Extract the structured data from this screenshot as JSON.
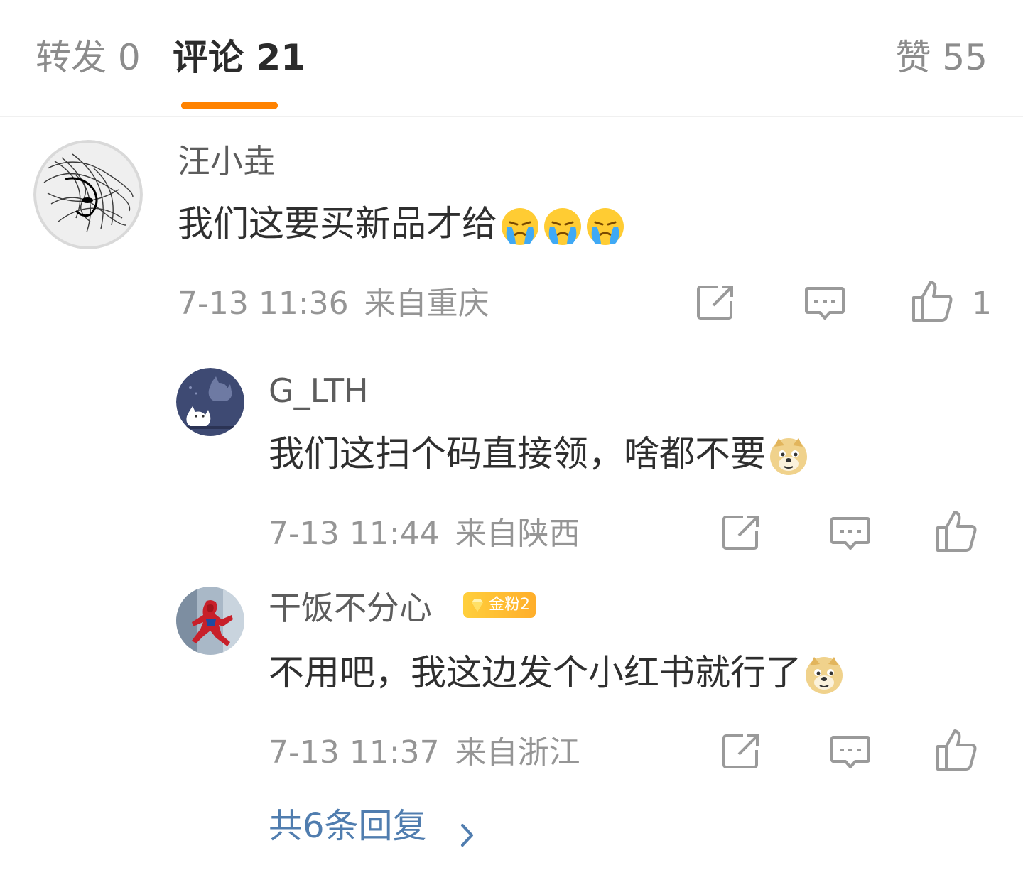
{
  "tabs": {
    "repost": "转发 0",
    "comments": "评论 21",
    "likes": "赞 55"
  },
  "colors": {
    "accent": "#ff8200",
    "link": "#507daf",
    "meta": "#959595"
  },
  "comment": {
    "user": "汪小垚",
    "text": "我们这要买新品才给",
    "emojis": [
      "crying-emoji",
      "crying-emoji",
      "crying-emoji"
    ],
    "time": "7-13 11:36",
    "location": "来自重庆",
    "like_count": "1"
  },
  "replies": [
    {
      "user": "G_LTH",
      "text": "我们这扫个码直接领，啥都不要",
      "emoji": "doge-emoji",
      "time": "7-13 11:44",
      "location": "来自陕西"
    },
    {
      "user": "干饭不分心",
      "badge": "金粉2",
      "text": "不用吧，我这边发个小红书就行了",
      "emoji": "doge-emoji",
      "time": "7-13 11:37",
      "location": "来自浙江"
    }
  ],
  "more_replies": "共6条回复"
}
